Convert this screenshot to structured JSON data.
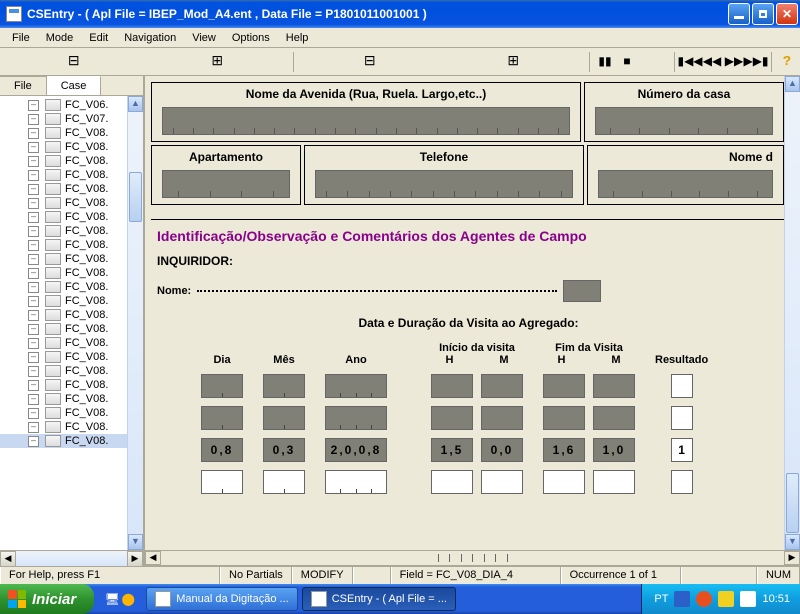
{
  "window": {
    "title": "CSEntry - ( Apl File = IBEP_Mod_A4.ent , Data File = P1801011001001 )"
  },
  "menu": {
    "file": "File",
    "mode": "Mode",
    "edit": "Edit",
    "nav": "Navigation",
    "view": "View",
    "options": "Options",
    "help": "Help"
  },
  "left": {
    "tab_file": "File",
    "tab_case": "Case",
    "items": [
      "FC_V06.",
      "FC_V07.",
      "FC_V08.",
      "FC_V08.",
      "FC_V08.",
      "FC_V08.",
      "FC_V08.",
      "FC_V08.",
      "FC_V08.",
      "FC_V08.",
      "FC_V08.",
      "FC_V08.",
      "FC_V08.",
      "FC_V08.",
      "FC_V08.",
      "FC_V08.",
      "FC_V08.",
      "FC_V08.",
      "FC_V08.",
      "FC_V08.",
      "FC_V08.",
      "FC_V08.",
      "FC_V08.",
      "FC_V08.",
      "FC_V08."
    ]
  },
  "form": {
    "avenida": "Nome da Avenida (Rua, Ruela. Largo,etc..)",
    "numero": "Número da casa",
    "apartamento": "Apartamento",
    "telefone": "Telefone",
    "nomed": "Nome d",
    "section": "Identificação/Observação e Comentários dos Agentes de Campo",
    "inquiridor": "INQUIRIDOR:",
    "nome": "Nome:",
    "visitTitle": "Data e Duração da Visita ao Agregado:",
    "hdr_dia": "Dia",
    "hdr_mes": "Mês",
    "hdr_ano": "Ano",
    "hdr_inicio": "Início da visita",
    "hdr_fim": "Fim da Visita",
    "hdr_res": "Resultado",
    "H": "H",
    "M": "M",
    "row3": {
      "dia": "0,8",
      "mes": "0,3",
      "ano": "2,0,0,8",
      "ih": "1,5",
      "im": "0,0",
      "fh": "1,6",
      "fm": "1,0",
      "res": "1"
    }
  },
  "status": {
    "help": "For Help, press F1",
    "partials": "No Partials",
    "mode": "MODIFY",
    "field": "Field = FC_V08_DIA_4",
    "occ": "Occurrence 1 of 1",
    "num": "NUM"
  },
  "taskbar": {
    "start": "Iniciar",
    "t1": "Manual da Digitação ...",
    "t2": "CSEntry - ( Apl File = ...",
    "lang": "PT",
    "clock": "10:51"
  }
}
